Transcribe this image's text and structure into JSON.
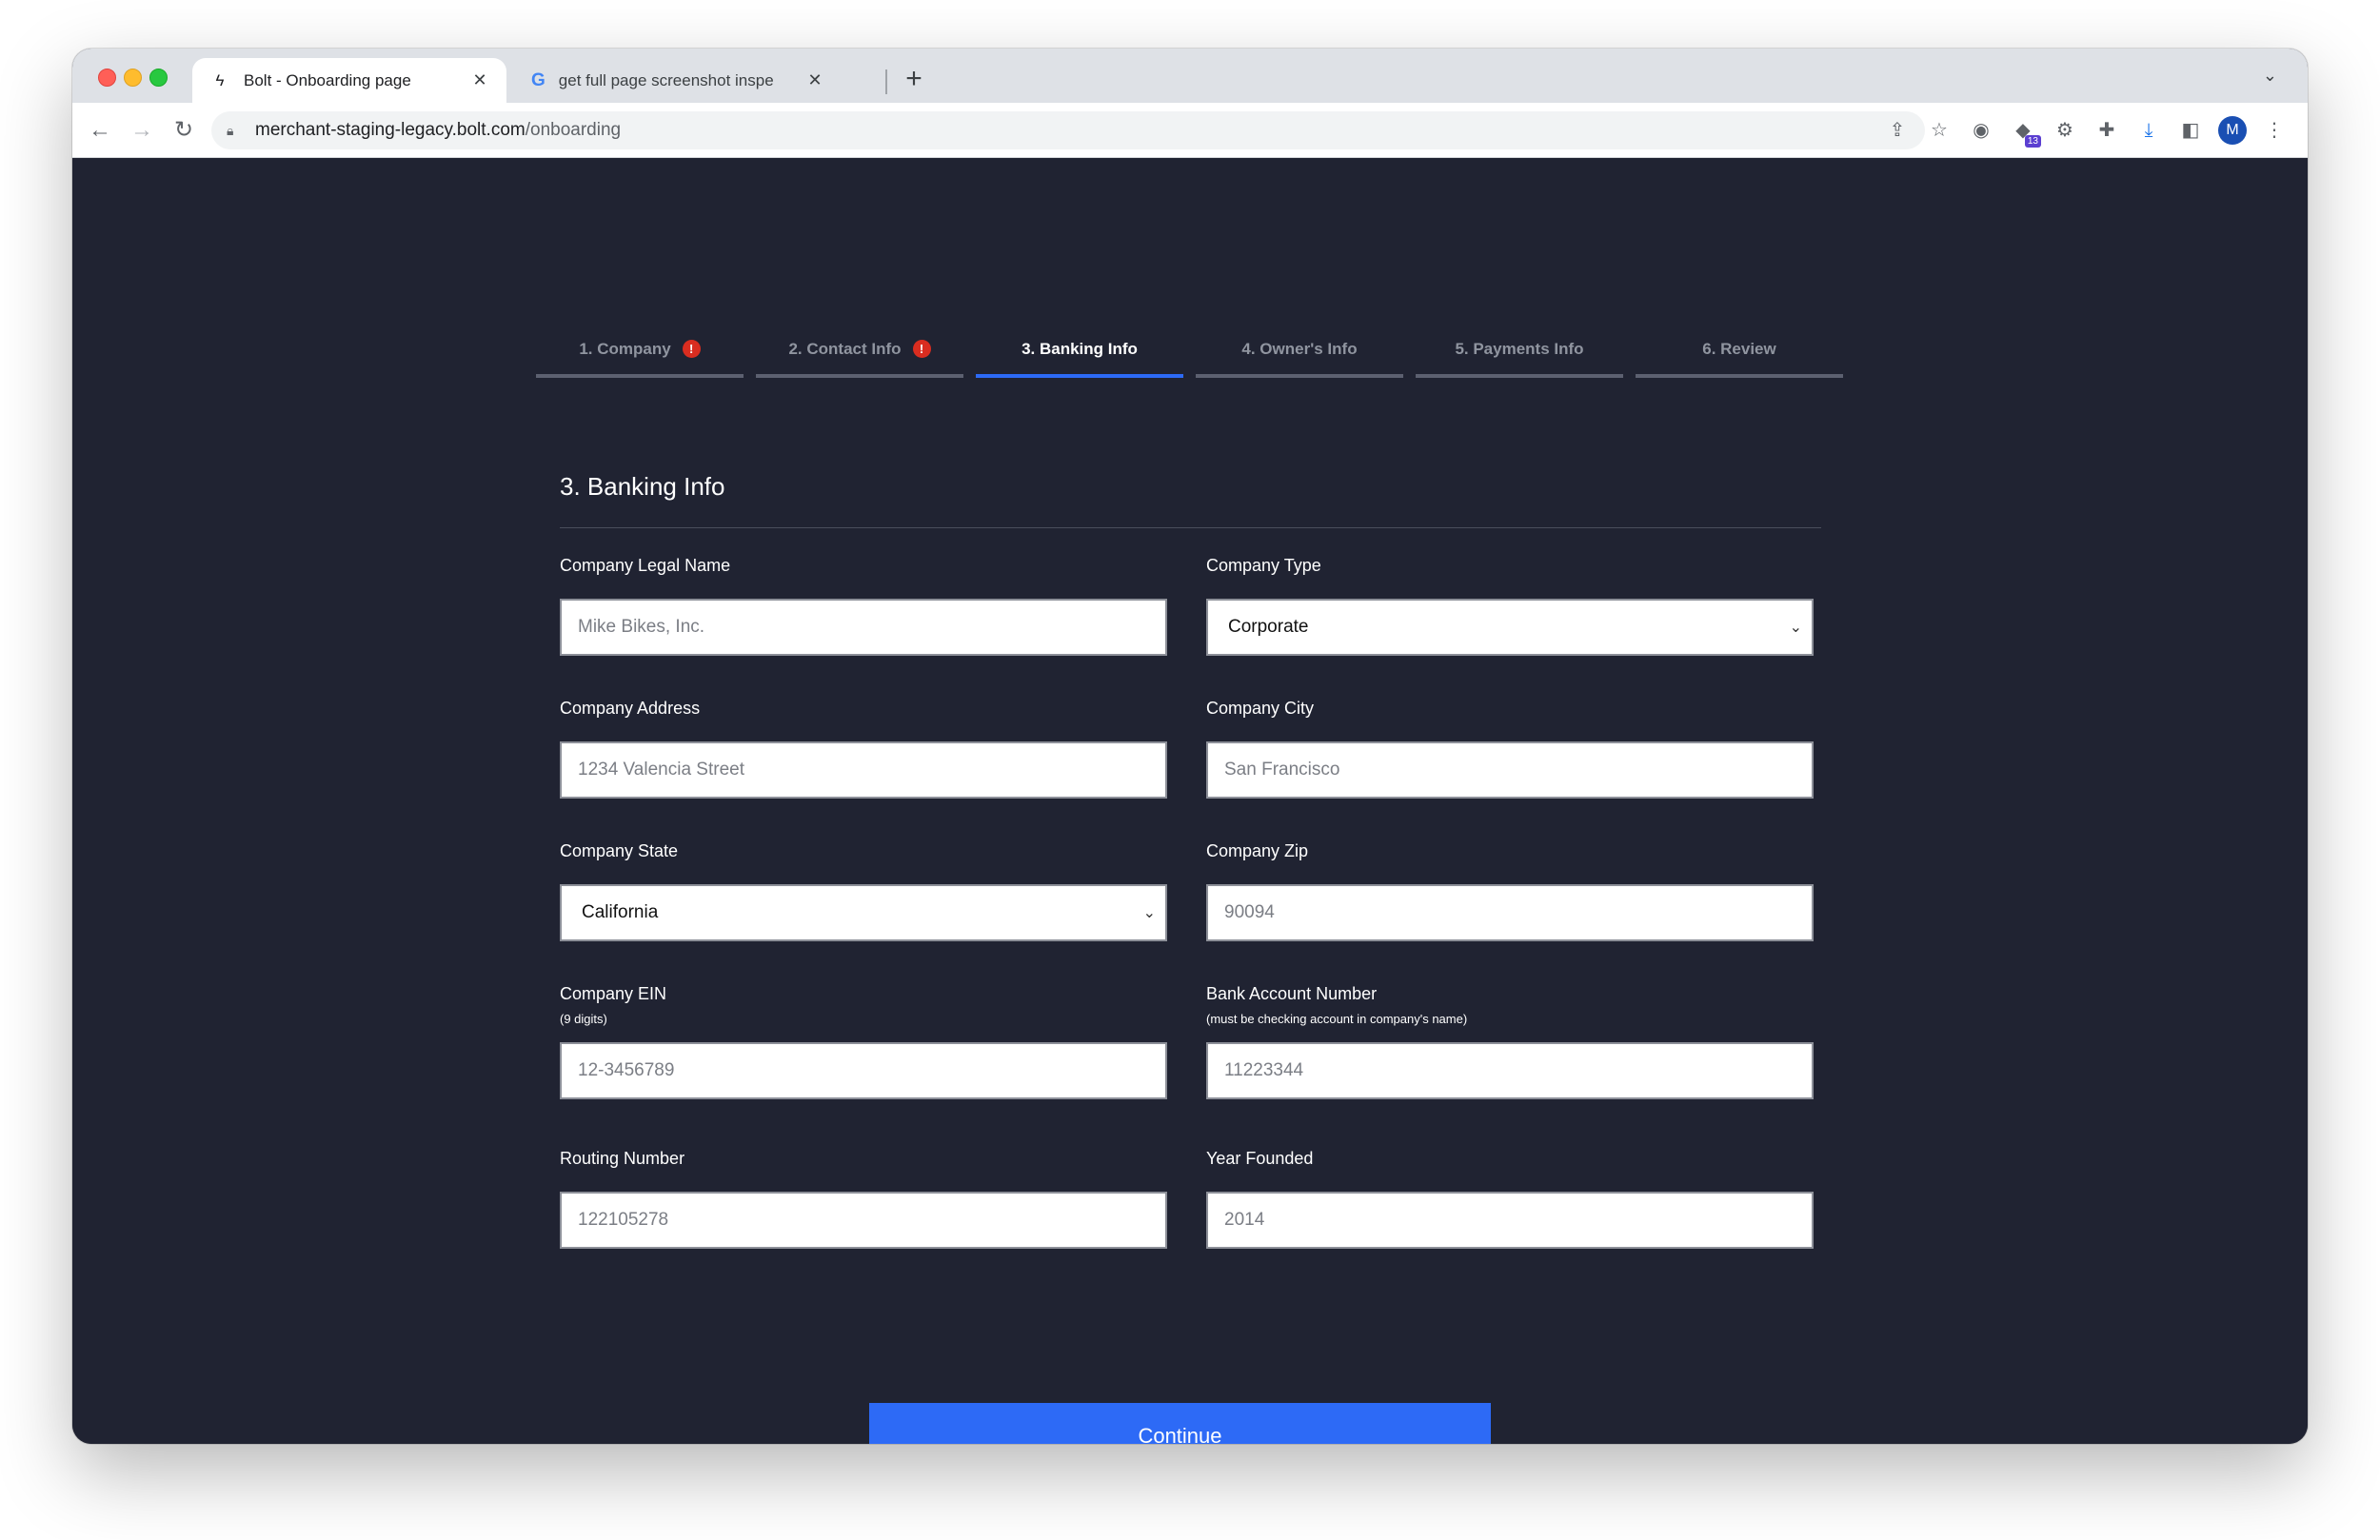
{
  "browser": {
    "tabs": [
      {
        "title": "Bolt - Onboarding page",
        "active": true
      },
      {
        "title": "get full page screenshot inspe",
        "active": false
      }
    ],
    "url_host": "merchant-staging-legacy.bolt.com",
    "url_path": "/onboarding",
    "extension_badge": "13",
    "profile_initial": "M"
  },
  "steps": [
    {
      "label": "1. Company",
      "warning": true,
      "active": false
    },
    {
      "label": "2. Contact Info",
      "warning": true,
      "active": false
    },
    {
      "label": "3. Banking Info",
      "warning": false,
      "active": true
    },
    {
      "label": "4. Owner's Info",
      "warning": false,
      "active": false
    },
    {
      "label": "5. Payments Info",
      "warning": false,
      "active": false
    },
    {
      "label": "6. Review",
      "warning": false,
      "active": false
    }
  ],
  "warning_glyph": "!",
  "section_title": "3. Banking Info",
  "form": {
    "legal_name": {
      "label": "Company Legal Name",
      "placeholder": "Mike Bikes, Inc."
    },
    "company_type": {
      "label": "Company Type",
      "value": "Corporate"
    },
    "address": {
      "label": "Company Address",
      "placeholder": "1234 Valencia Street"
    },
    "city": {
      "label": "Company City",
      "placeholder": "San Francisco"
    },
    "state": {
      "label": "Company State",
      "value": "California"
    },
    "zip": {
      "label": "Company Zip",
      "placeholder": "90094"
    },
    "ein": {
      "label": "Company EIN",
      "hint": "(9 digits)",
      "placeholder": "12-3456789"
    },
    "bank_account": {
      "label": "Bank Account Number",
      "hint": "(must be checking account in company's name)",
      "placeholder": "11223344"
    },
    "routing": {
      "label": "Routing Number",
      "placeholder": "122105278"
    },
    "year_founded": {
      "label": "Year Founded",
      "placeholder": "2014"
    }
  },
  "continue_label": "Continue",
  "colors": {
    "accent": "#2d6af6",
    "background": "#202332",
    "warning": "#d92d20"
  }
}
